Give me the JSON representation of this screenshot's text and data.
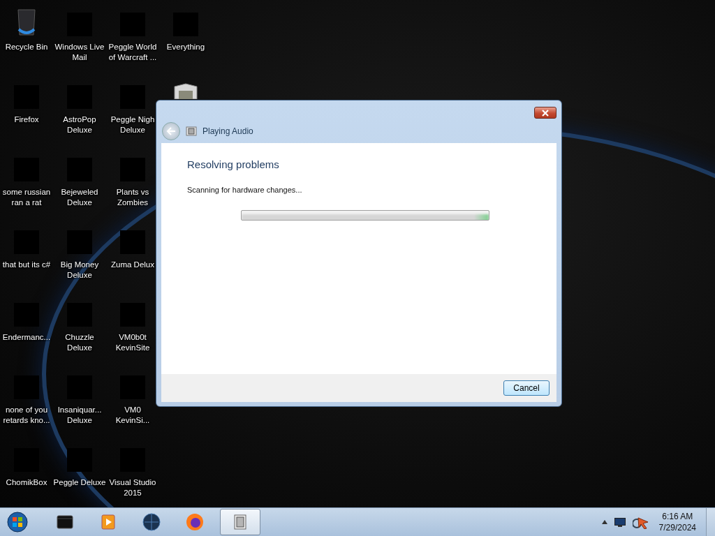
{
  "desktop_icons": [
    {
      "label": "Recycle Bin",
      "kind": "bin"
    },
    {
      "label": "Firefox",
      "kind": "app"
    },
    {
      "label": "some russian\nran a rat",
      "kind": "app"
    },
    {
      "label": "that but its c#",
      "kind": "app"
    },
    {
      "label": "Endermanc...",
      "kind": "app"
    },
    {
      "label": "none of you\nretards kno...",
      "kind": "app"
    },
    {
      "label": "ChomikBox",
      "kind": "app"
    },
    {
      "label": "Windows Live\nMail",
      "kind": "app"
    },
    {
      "label": "AstroPop\nDeluxe",
      "kind": "app"
    },
    {
      "label": "Bejeweled\nDeluxe",
      "kind": "app"
    },
    {
      "label": "Big Money\nDeluxe",
      "kind": "app"
    },
    {
      "label": "Chuzzle\nDeluxe",
      "kind": "app"
    },
    {
      "label": "Insaniquar...\nDeluxe",
      "kind": "app"
    },
    {
      "label": "Peggle Deluxe",
      "kind": "app"
    },
    {
      "label": "Peggle World\nof Warcraft ...",
      "kind": "app"
    },
    {
      "label": "Peggle Nigh\nDeluxe",
      "kind": "app"
    },
    {
      "label": "Plants vs\nZombies",
      "kind": "app"
    },
    {
      "label": "Zuma Delux",
      "kind": "app"
    },
    {
      "label": "VM0b0t\nKevinSite",
      "kind": "app"
    },
    {
      "label": "VM0\nKevinSi...",
      "kind": "app"
    },
    {
      "label": "Visual Studio\n2015",
      "kind": "app"
    },
    {
      "label": "Everything",
      "kind": "app"
    },
    {
      "kind": "folder"
    }
  ],
  "dialog": {
    "title": "Playing Audio",
    "heading": "Resolving problems",
    "status": "Scanning for hardware changes...",
    "progress": {
      "indeterminate": true
    },
    "buttons": [
      {
        "label": "Cancel"
      }
    ]
  },
  "taskbar": {
    "items": [
      {
        "kind": "box",
        "selected": false
      },
      {
        "kind": "player",
        "selected": false
      },
      {
        "kind": "globe",
        "selected": false
      },
      {
        "kind": "browser",
        "selected": false
      },
      {
        "kind": "troubleshooter",
        "selected": true
      }
    ],
    "clock": {
      "time": "6:16 AM",
      "date": "7/29/2024"
    }
  }
}
